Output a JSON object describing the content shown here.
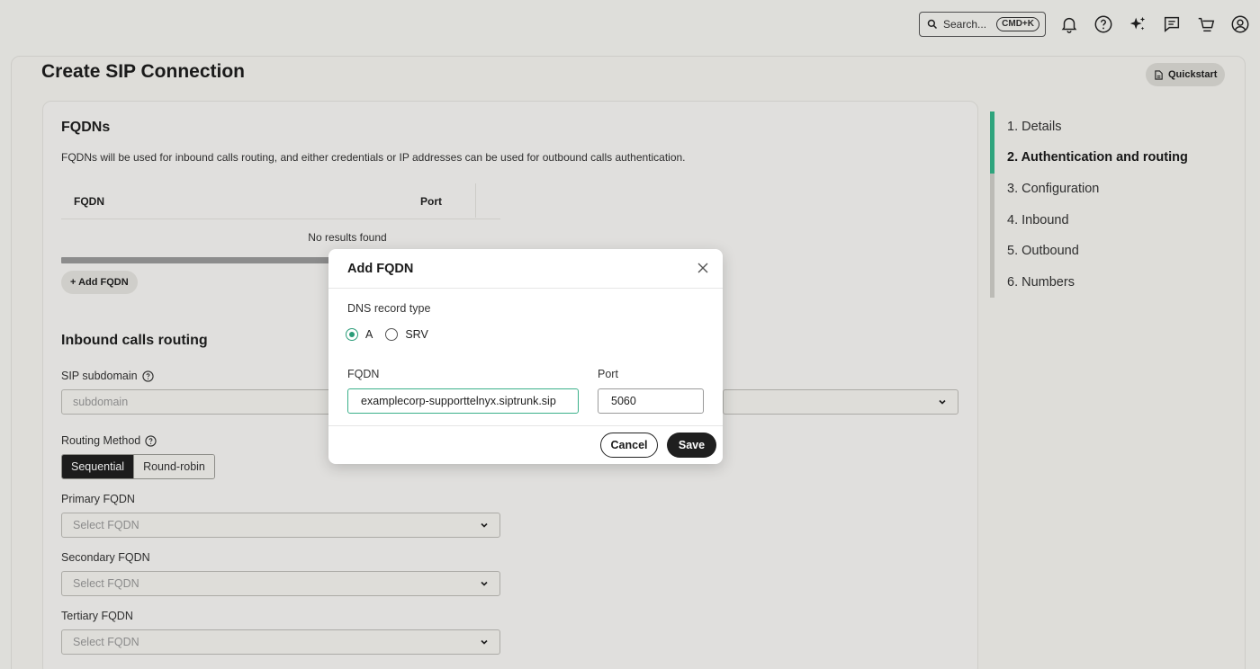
{
  "topbar": {
    "search_label": "Search...",
    "search_shortcut": "CMD+K",
    "icons": [
      "search-icon",
      "bell-icon",
      "help-icon",
      "sparkle-icon",
      "chat-icon",
      "cart-icon",
      "user-icon"
    ]
  },
  "page": {
    "title": "Create SIP Connection",
    "quickstart_label": "Quickstart"
  },
  "fqdns": {
    "title": "FQDNs",
    "description": "FQDNs will be used for inbound calls routing, and either credentials or IP addresses can be used for outbound calls authentication.",
    "columns": [
      "FQDN",
      "Port"
    ],
    "empty_text": "No results found",
    "add_label": "+ Add FQDN"
  },
  "inbound": {
    "title": "Inbound calls routing",
    "subdomain_label": "SIP subdomain",
    "subdomain_placeholder": "subdomain",
    "routing_label": "Routing Method",
    "routing_options": [
      "Sequential",
      "Round-robin"
    ],
    "routing_selected": "Sequential",
    "primary_label": "Primary FQDN",
    "secondary_label": "Secondary FQDN",
    "tertiary_label": "Tertiary FQDN",
    "select_placeholder": "Select FQDN"
  },
  "steps": [
    {
      "label": "1. Details"
    },
    {
      "label": "2. Authentication and routing"
    },
    {
      "label": "3. Configuration"
    },
    {
      "label": "4. Inbound"
    },
    {
      "label": "5. Outbound"
    },
    {
      "label": "6. Numbers"
    }
  ],
  "steps_current": "2. Authentication and routing",
  "modal": {
    "title": "Add FQDN",
    "dns_label": "DNS record type",
    "dns_options": [
      "A",
      "SRV"
    ],
    "dns_selected": "A",
    "fqdn_label": "FQDN",
    "fqdn_value": "examplecorp-supporttelnyx.siptrunk.sip",
    "port_label": "Port",
    "port_value": "5060",
    "cancel_label": "Cancel",
    "save_label": "Save"
  },
  "colors": {
    "accent": "#34b58a",
    "dark": "#1f1f1f"
  }
}
